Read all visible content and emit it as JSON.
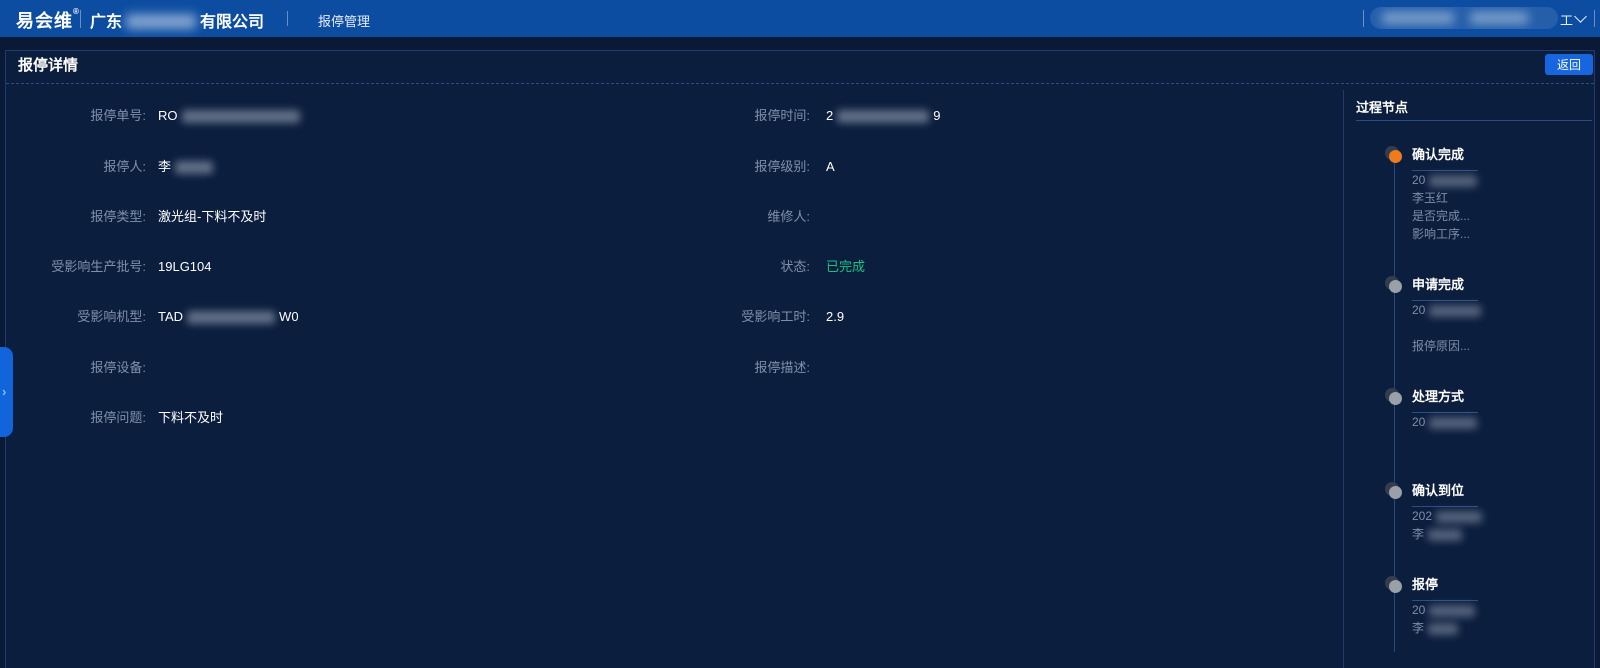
{
  "navbar": {
    "logo_text": "易会维",
    "logo_reg_mark": "®",
    "company_name_prefix": "广东",
    "company_name_suffix": "有限公司",
    "nav_item_label": "报停管理",
    "user_visible_text": "工"
  },
  "icons": {
    "chevron_down": "∨",
    "drawer_expand": "›"
  },
  "page": {
    "title": "报停详情",
    "back_button_label": "返回"
  },
  "detail_form": {
    "left_rows": [
      {
        "label": "报停单号:",
        "segments": [
          {
            "t": "RO"
          },
          {
            "b": 118
          }
        ]
      },
      {
        "label": "报停人:",
        "segments": [
          {
            "t": "李"
          },
          {
            "b": 38
          }
        ]
      },
      {
        "label": "报停类型:",
        "segments": [
          {
            "t": "激光组-下料不及时"
          }
        ]
      },
      {
        "label": "受影响生产批号:",
        "segments": [
          {
            "t": "19LG104"
          }
        ]
      },
      {
        "label": "受影响机型:",
        "segments": [
          {
            "t": "TAD"
          },
          {
            "b": 88
          },
          {
            "t": "W0"
          }
        ]
      },
      {
        "label": "报停设备:",
        "segments": []
      },
      {
        "label": "报停问题:",
        "segments": [
          {
            "t": "下料不及时"
          }
        ]
      }
    ],
    "right_rows": [
      {
        "label": "报停时间:",
        "segments": [
          {
            "t": "2"
          },
          {
            "b": 92
          },
          {
            "t": "9"
          }
        ]
      },
      {
        "label": "报停级别:",
        "segments": [
          {
            "t": "A"
          }
        ]
      },
      {
        "label": "维修人:",
        "segments": []
      },
      {
        "label": "状态:",
        "segments": [
          {
            "t": "已完成",
            "color": "#18c383"
          }
        ]
      },
      {
        "label": "受影响工时:",
        "segments": [
          {
            "t": "2.9"
          }
        ]
      },
      {
        "label": "报停描述:",
        "segments": []
      }
    ]
  },
  "process_panel": {
    "title": "过程节点",
    "nodes": [
      {
        "title": "确认完成",
        "state": "active",
        "lines": [
          [
            {
              "t": "20"
            },
            {
              "b": 48
            }
          ],
          [
            {
              "t": "李玉红"
            }
          ],
          [
            {
              "t": "是否完成..."
            }
          ],
          [
            {
              "t": "影响工序..."
            }
          ]
        ]
      },
      {
        "title": "申请完成",
        "state": "done",
        "lines": [
          [
            {
              "t": "20"
            },
            {
              "b": 52
            }
          ],
          [],
          [
            {
              "t": "报停原因..."
            }
          ]
        ]
      },
      {
        "title": "处理方式",
        "state": "done",
        "lines": [
          [
            {
              "t": "20"
            },
            {
              "b": 48
            }
          ]
        ]
      },
      {
        "title": "确认到位",
        "state": "done",
        "lines": [
          [
            {
              "t": "202"
            },
            {
              "b": 46
            }
          ],
          [
            {
              "t": "李"
            },
            {
              "b": 34
            }
          ]
        ]
      },
      {
        "title": "报停",
        "state": "done",
        "lines": [
          [
            {
              "t": "20"
            },
            {
              "b": 46
            }
          ],
          [
            {
              "t": "李"
            },
            {
              "b": 30
            }
          ]
        ]
      }
    ]
  },
  "colors": {
    "navbar_blue": "#0d4da1",
    "page_background": "#0a1a36",
    "panel_background": "#0c1e3e",
    "accent_blue": "#1766e0",
    "status_done_green": "#18c383",
    "active_node_orange": "#ef7b1a",
    "inactive_node_grey": "#9aa0a8",
    "label_grey": "#8090ab",
    "line_blue": "#27477f"
  }
}
